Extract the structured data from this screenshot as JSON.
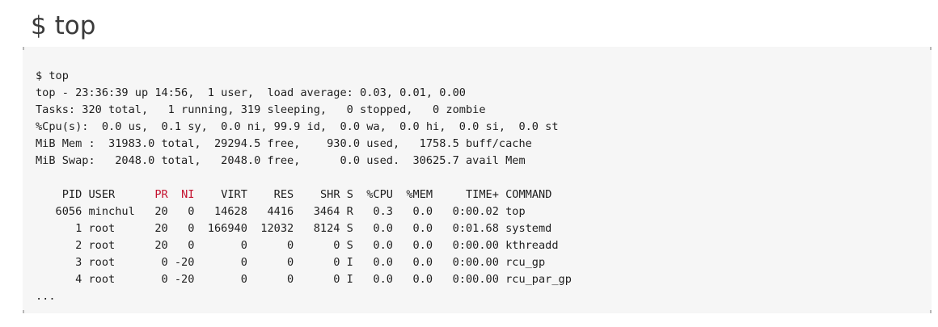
{
  "page": {
    "title": "$ top"
  },
  "terminal": {
    "highlight_color": "#c4122f",
    "lines": [
      "$ top",
      "top - 23:36:39 up 14:56,  1 user,  load average: 0.03, 0.01, 0.00",
      "Tasks: 320 total,   1 running, 319 sleeping,   0 stopped,   0 zombie",
      "%Cpu(s):  0.0 us,  0.1 sy,  0.0 ni, 99.9 id,  0.0 wa,  0.0 hi,  0.0 si,  0.0 st",
      "MiB Mem :  31983.0 total,  29294.5 free,    930.0 used,   1758.5 buff/cache",
      "MiB Swap:   2048.0 total,   2048.0 free,      0.0 used.  30625.7 avail Mem",
      ""
    ],
    "header": {
      "pid_user": "    PID USER      ",
      "pr": "PR",
      "gap": "  ",
      "ni": "NI",
      "rest": "    VIRT    RES    SHR S  %CPU  %MEM     TIME+ COMMAND"
    },
    "processes": [
      "   6056 minchul   20   0   14628   4416   3464 R   0.3   0.0   0:00.02 top",
      "      1 root      20   0  166940  12032   8124 S   0.0   0.0   0:01.68 systemd",
      "      2 root      20   0       0      0      0 S   0.0   0.0   0:00.00 kthreadd",
      "      3 root       0 -20       0      0      0 I   0.0   0.0   0:00.00 rcu_gp",
      "      4 root       0 -20       0      0      0 I   0.0   0.0   0:00.00 rcu_par_gp"
    ],
    "ellipsis": "..."
  }
}
